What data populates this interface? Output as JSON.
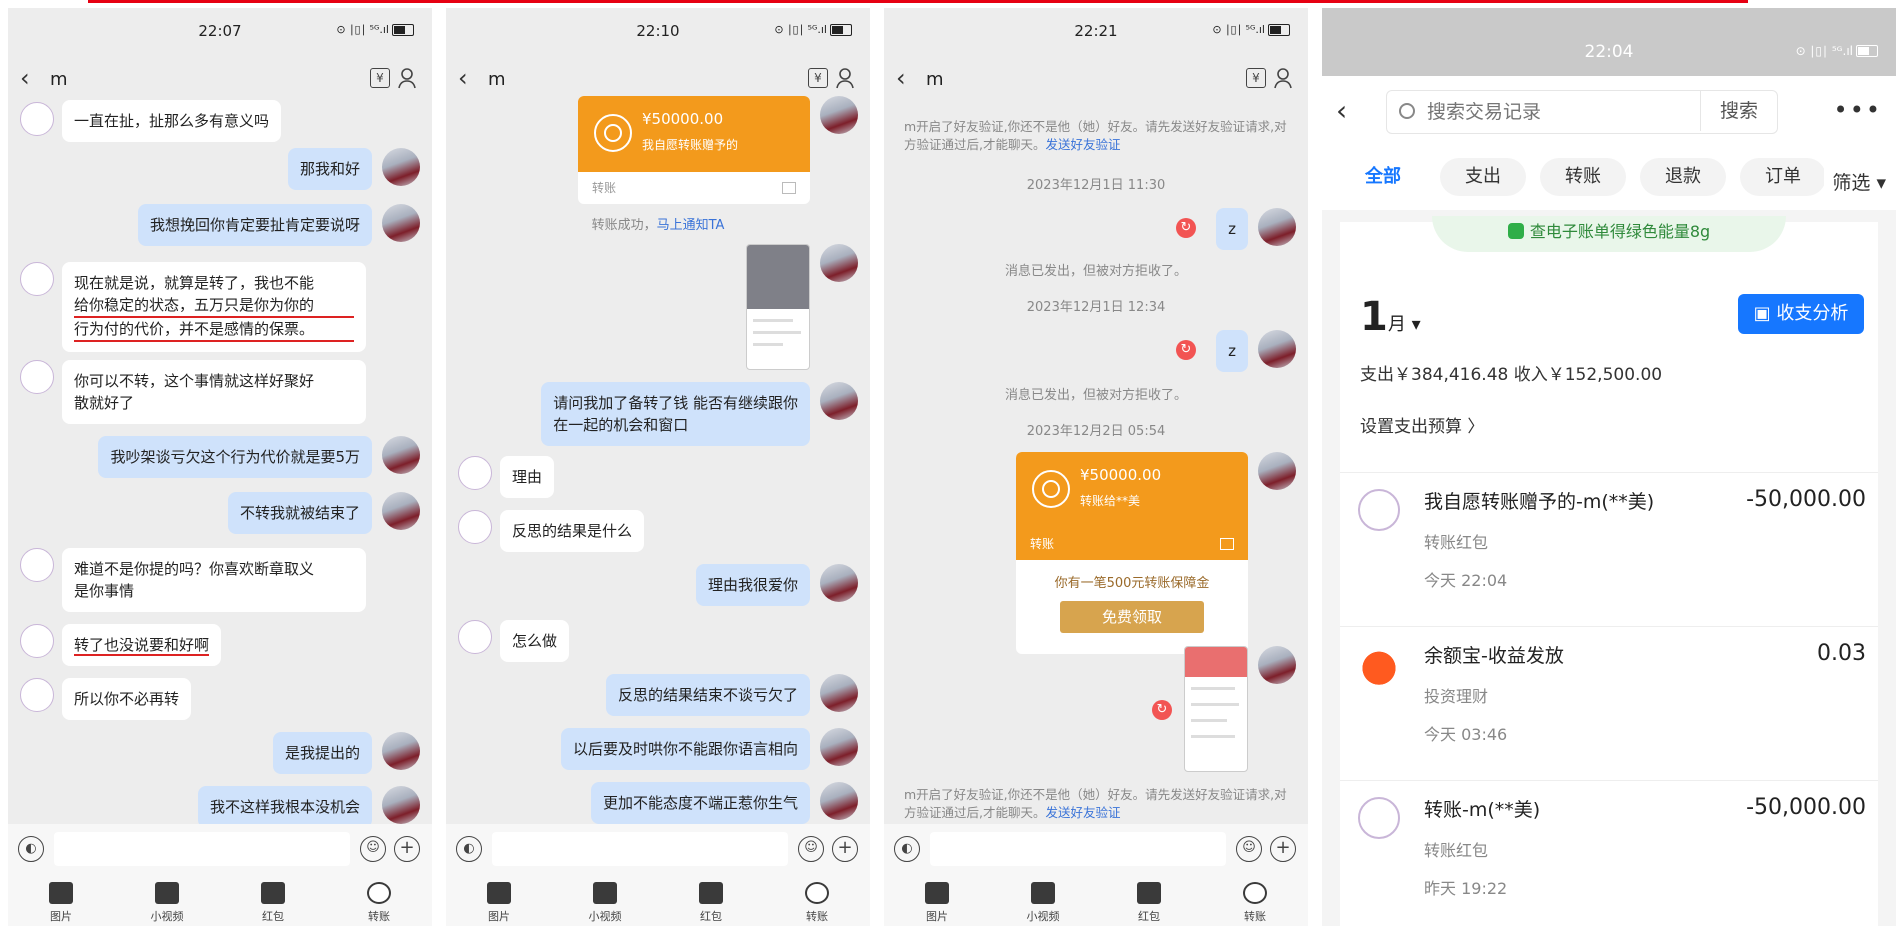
{
  "panels": [
    {
      "time": "22:07",
      "contact": "m",
      "status_icons": "⊙ ∣▯∣ ⁵ᴳ.ıl",
      "messages": [
        {
          "side": "l",
          "text": "一直在扯，扯那么多有意义吗"
        },
        {
          "side": "r",
          "text": "那我和好"
        },
        {
          "side": "r",
          "text": "我想挽回你肯定要扯肯定要说呀"
        },
        {
          "side": "l",
          "lines": [
            "现在就是说，就算是转了，我也不能",
            "给你稳定的状态，五万只是你为你的",
            "行为付的代价，并不是感情的保票。"
          ]
        },
        {
          "side": "l",
          "lines": [
            "你可以不转，这个事情就这样好聚好",
            "散就好了"
          ]
        },
        {
          "side": "r",
          "text": "我吵架谈亏欠这个行为代价就是要5万"
        },
        {
          "side": "r",
          "text": "不转我就被结束了"
        },
        {
          "side": "l",
          "lines": [
            "难道不是你提的吗？你喜欢断章取义",
            "是你事情"
          ]
        },
        {
          "side": "l",
          "text": "转了也没说要和好啊"
        },
        {
          "side": "l",
          "text": "所以你不必再转"
        },
        {
          "side": "r",
          "text": "是我提出的"
        },
        {
          "side": "r",
          "text": "我不这样我根本没机会"
        }
      ]
    },
    {
      "time": "22:10",
      "contact": "m",
      "status_icons": "⊙ ∣▯∣ ⁵ᴳ.ıl",
      "transfer": {
        "amount": "¥50000.00",
        "desc": "我自愿转账赠予的",
        "foot": "转账"
      },
      "transfer_ok": "转账成功，",
      "notify": "马上通知TA",
      "messages": [
        {
          "side": "r",
          "lines": [
            "请问我加了备转了钱  能否有继续跟你",
            "在一起的机会和窗口"
          ]
        },
        {
          "side": "l",
          "text": "理由"
        },
        {
          "side": "l",
          "text": "反思的结果是什么"
        },
        {
          "side": "r",
          "text": "理由我很爱你"
        },
        {
          "side": "l",
          "text": "怎么做"
        },
        {
          "side": "r",
          "text": "反思的结果结束不谈亏欠了"
        },
        {
          "side": "r",
          "text": "以后要及时哄你不能跟你语言相向"
        },
        {
          "side": "r",
          "text": "更加不能态度不端正惹你生气"
        }
      ]
    },
    {
      "time": "22:21",
      "contact": "m",
      "status_icons": "⊙ ∣▯∣ ⁵ᴳ.ıl",
      "notice": "m开启了好友验证,你还不是他（她）好友。请先发送好友验证请求,对方验证通过后,才能聊天。",
      "notice_link": "发送好友验证",
      "ts1": "2023年12月1日 11:30",
      "z1": "z",
      "rejected1": "消息已发出，但被对方拒收了。",
      "ts2": "2023年12月1日 12:34",
      "z2": "z",
      "rejected2": "消息已发出，但被对方拒收了。",
      "ts3": "2023年12月2日 05:54",
      "transfer": {
        "amount": "¥50000.00",
        "desc": "转账给**美",
        "foot": "转账"
      },
      "guard": "你有一笔500元转账保障金",
      "guard_btn": "免费领取"
    }
  ],
  "chat_tools": [
    {
      "name": "图片"
    },
    {
      "name": "小视频"
    },
    {
      "name": "红包"
    },
    {
      "name": "转账"
    }
  ],
  "ledger": {
    "time": "22:04",
    "status_icons": "⊙ ∣▯∣ ⁵ᴳ.ıl",
    "search_placeholder": "搜索交易记录",
    "search_btn": "搜索",
    "more": "•••",
    "chips": [
      "全部",
      "支出",
      "转账",
      "退款",
      "订单"
    ],
    "filter": "筛选 ▾",
    "eco": "查电子账单得绿色能量8g",
    "month": "1",
    "month_unit": "月 ▾",
    "analyze": "收支分析",
    "totals": "支出￥384,416.48     收入￥152,500.00",
    "budget": "设置支出预算  〉",
    "items": [
      {
        "title": "我自愿转账赠予的-m(**美)",
        "cat": "转账红包",
        "time": "今天 22:04",
        "amount": "-50,000.00"
      },
      {
        "title": "余额宝-收益发放",
        "cat": "投资理财",
        "time": "今天 03:46",
        "amount": "0.03"
      },
      {
        "title": "转账-m(**美)",
        "cat": "转账红包",
        "time": "昨天 19:22",
        "amount": "-50,000.00"
      }
    ]
  }
}
